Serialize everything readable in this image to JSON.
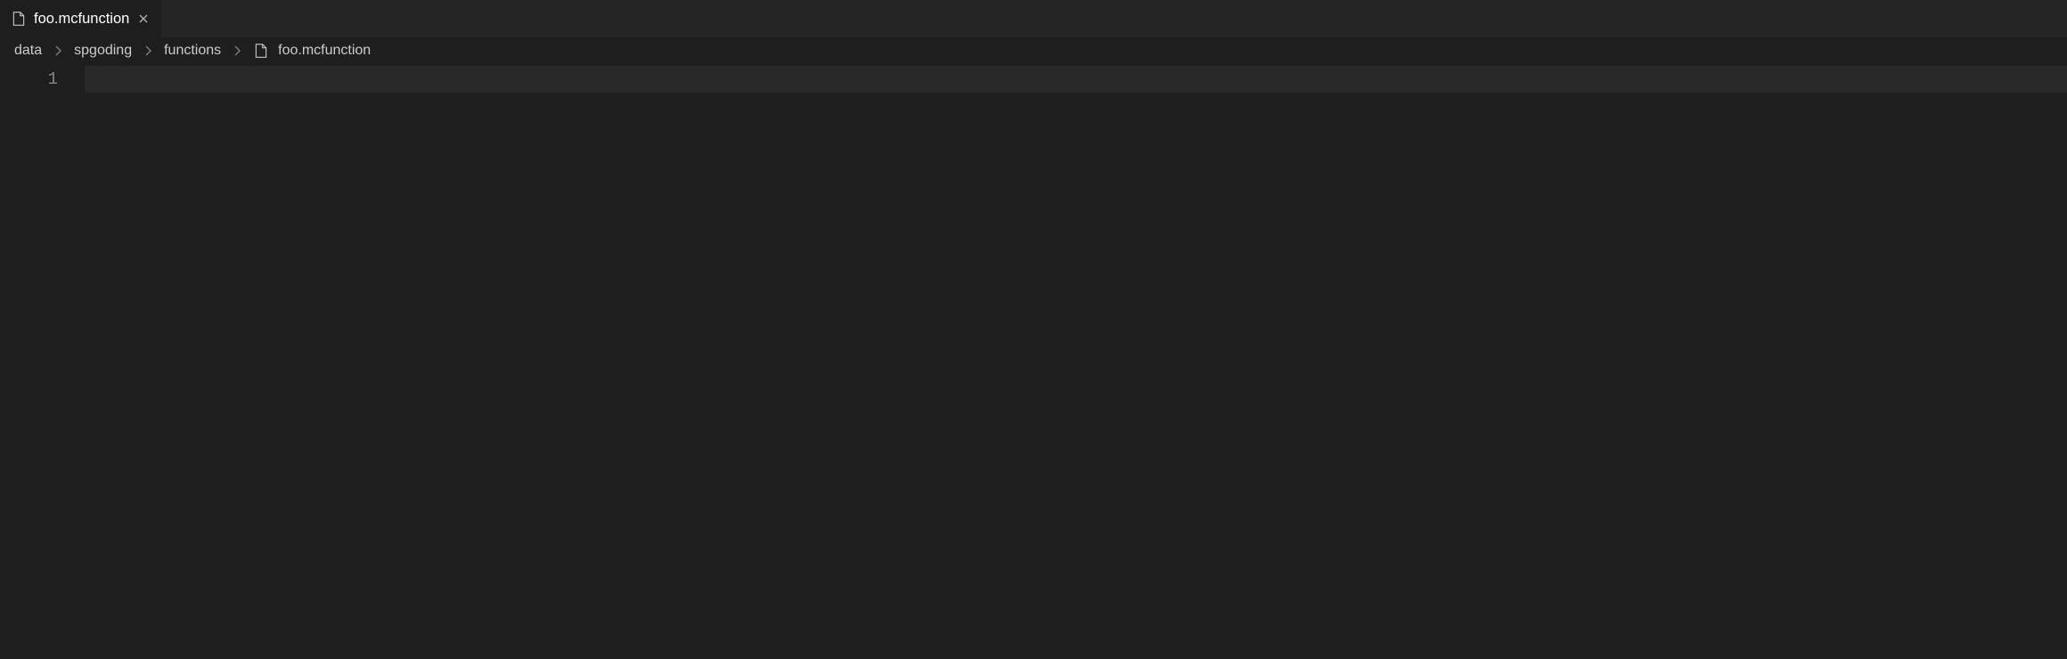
{
  "tab": {
    "filename": "foo.mcfunction"
  },
  "breadcrumb": {
    "segments": [
      "data",
      "spgoding",
      "functions"
    ],
    "filename": "foo.mcfunction"
  },
  "editor": {
    "line_numbers": [
      "1"
    ]
  }
}
